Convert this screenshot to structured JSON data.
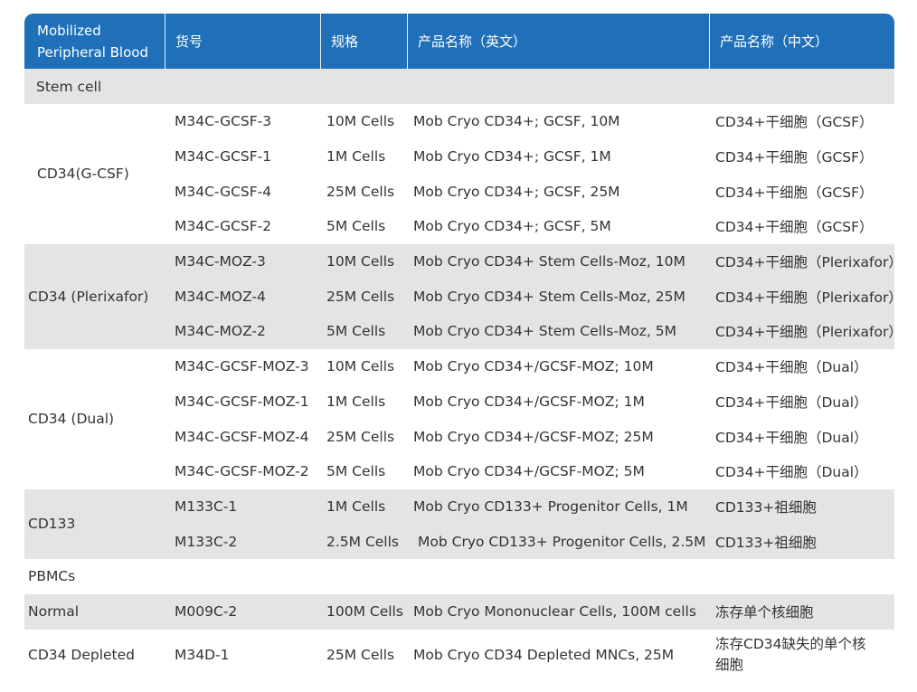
{
  "header": {
    "col1": "Mobilized Peripheral Blood",
    "col2": "货号",
    "col3": "规格",
    "col4": "产品名称（英文）",
    "col5": "产品名称（中文）"
  },
  "sections": {
    "stem_cell": "Stem cell",
    "pbmcs": "PBMCs"
  },
  "groups": [
    {
      "name": "CD34(G-CSF)",
      "rows": [
        {
          "sku": "M34C-GCSF-3",
          "spec": "10M Cells",
          "en": "Mob Cryo CD34+; GCSF, 10M",
          "cn": "CD34+干细胞（GCSF）"
        },
        {
          "sku": "M34C-GCSF-1",
          "spec": "1M Cells",
          "en": "Mob Cryo CD34+; GCSF, 1M",
          "cn": "CD34+干细胞（GCSF）"
        },
        {
          "sku": "M34C-GCSF-4",
          "spec": "25M Cells",
          "en": "Mob Cryo CD34+; GCSF, 25M",
          "cn": "CD34+干细胞（GCSF）"
        },
        {
          "sku": "M34C-GCSF-2",
          "spec": "5M Cells",
          "en": "Mob Cryo CD34+; GCSF, 5M",
          "cn": "CD34+干细胞（GCSF）"
        }
      ]
    },
    {
      "name": "CD34 (Plerixafor)",
      "rows": [
        {
          "sku": "M34C-MOZ-3",
          "spec": "10M Cells",
          "en": "Mob Cryo CD34+ Stem Cells-Moz, 10M",
          "cn": "CD34+干细胞（Plerixafor）"
        },
        {
          "sku": "M34C-MOZ-4",
          "spec": "25M Cells",
          "en": "Mob Cryo CD34+ Stem Cells-Moz, 25M",
          "cn": "CD34+干细胞（Plerixafor）"
        },
        {
          "sku": "M34C-MOZ-2",
          "spec": "5M Cells",
          "en": "Mob Cryo CD34+ Stem Cells-Moz, 5M",
          "cn": "CD34+干细胞（Plerixafor）"
        }
      ]
    },
    {
      "name": "CD34 (Dual)",
      "rows": [
        {
          "sku": "M34C-GCSF-MOZ-3",
          "spec": "10M Cells",
          "en": "Mob Cryo CD34+/GCSF-MOZ; 10M",
          "cn": "CD34+干细胞（Dual）"
        },
        {
          "sku": "M34C-GCSF-MOZ-1",
          "spec": "1M Cells",
          "en": "Mob Cryo CD34+/GCSF-MOZ; 1M",
          "cn": "CD34+干细胞（Dual）"
        },
        {
          "sku": "M34C-GCSF-MOZ-4",
          "spec": "25M Cells",
          "en": "Mob Cryo CD34+/GCSF-MOZ; 25M",
          "cn": "CD34+干细胞（Dual）"
        },
        {
          "sku": "M34C-GCSF-MOZ-2",
          "spec": "5M Cells",
          "en": "Mob Cryo CD34+/GCSF-MOZ; 5M",
          "cn": "CD34+干细胞（Dual）"
        }
      ]
    },
    {
      "name": "CD133",
      "rows": [
        {
          "sku": "M133C-1",
          "spec": "1M Cells",
          "en": "Mob Cryo CD133+ Progenitor Cells, 1M",
          "cn": "CD133+祖细胞"
        },
        {
          "sku": "M133C-2",
          "spec": "2.5M Cells",
          "en": "Mob Cryo CD133+ Progenitor Cells, 2.5M",
          "cn": "CD133+祖细胞"
        }
      ]
    },
    {
      "name": "Normal",
      "rows": [
        {
          "sku": "M009C-2",
          "spec": "100M Cells",
          "en": "Mob Cryo Mononuclear Cells, 100M cells",
          "cn": "冻存单个核细胞"
        }
      ]
    },
    {
      "name": "CD34 Depleted",
      "rows": [
        {
          "sku": "M34D-1",
          "spec": "25M Cells",
          "en": "Mob Cryo CD34 Depleted MNCs, 25M",
          "cn": "冻存CD34缺失的单个核细胞"
        }
      ]
    }
  ],
  "colors": {
    "header_bg": "#1f70b8",
    "shade_bg": "#e4e4e4",
    "text": "#333333"
  }
}
